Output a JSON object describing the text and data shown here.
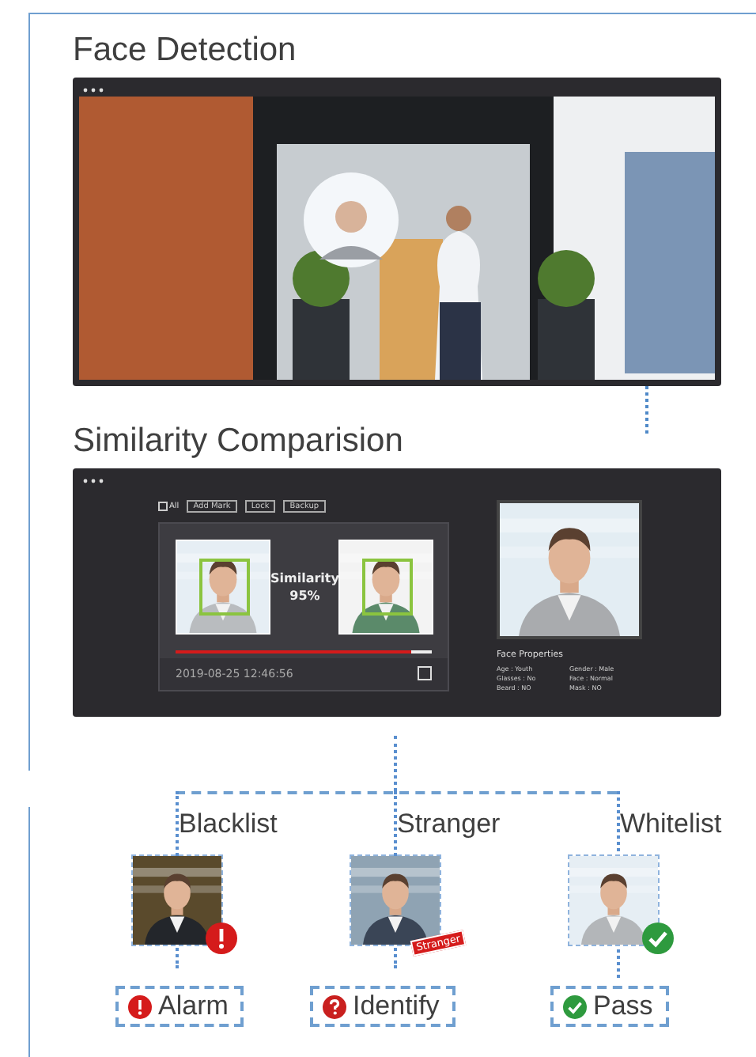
{
  "face_detection": {
    "title": "Face Detection"
  },
  "similarity": {
    "title": "Similarity Comparision",
    "toolbar": {
      "select_all": {
        "label": "All",
        "checked": false
      },
      "buttons": [
        "Add Mark",
        "Lock",
        "Backup"
      ]
    },
    "match": {
      "label": "Similarity",
      "value": "95%",
      "level": 0.92,
      "timestamp": "2019-08-25 12:46:56",
      "checked": false
    },
    "properties": {
      "title": "Face Properties",
      "items": [
        {
          "name": "Age :",
          "value": "Youth"
        },
        {
          "name": "Gender :",
          "value": "Male"
        },
        {
          "name": "Glasses :",
          "value": "No"
        },
        {
          "name": "Face :",
          "value": "Normal"
        },
        {
          "name": "Beard :",
          "value": "NO"
        },
        {
          "name": "Mask :",
          "value": "NO"
        }
      ]
    }
  },
  "outcomes": [
    {
      "label": "Blacklist",
      "kind": "alarm",
      "action": "Alarm"
    },
    {
      "label": "Stranger",
      "kind": "identify",
      "action": "Identify",
      "tag": "Stranger"
    },
    {
      "label": "Whitelist",
      "kind": "pass",
      "action": "Pass"
    }
  ]
}
